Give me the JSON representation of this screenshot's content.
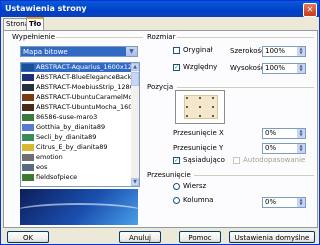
{
  "dialog": {
    "title": "Ustawienia strony",
    "close_glyph": "✕"
  },
  "tabs": [
    {
      "label": "Strona"
    },
    {
      "label": "Tło"
    }
  ],
  "fill": {
    "section_label": "Wypełnienie",
    "type_value": "Mapa bitowe",
    "images": [
      {
        "name": "ABSTRACT-Aquarius_1600x1200",
        "color": "#1b4f9b"
      },
      {
        "name": "ABSTRACT-BlueEleganceBackgrou",
        "color": "#1f2f7a"
      },
      {
        "name": "ABSTRACT-MoebiusStrip_1280x10",
        "color": "#27313d"
      },
      {
        "name": "ABSTRACT-UbuntuCaramelMocha",
        "color": "#7a3b12"
      },
      {
        "name": "ABSTRACT-UbuntuMocha_1600x1",
        "color": "#4a2a15"
      },
      {
        "name": "86586-suse-maro3",
        "color": "#3a7a3a"
      },
      {
        "name": "Gotthia_by_dianita89",
        "color": "#5a7ad0"
      },
      {
        "name": "Secli_by_dianita89",
        "color": "#3a8a5a"
      },
      {
        "name": "Citrus_E_by_dianita89",
        "color": "#d8b830"
      },
      {
        "name": "emotion",
        "color": "#6f6f6f"
      },
      {
        "name": "eos",
        "color": "#5a6a80"
      },
      {
        "name": "fieldsofpiece",
        "color": "#3d7a30"
      }
    ]
  },
  "size": {
    "section_label": "Rozmiar",
    "original_label": "Oryginał",
    "relative_label": "Względny",
    "width_label": "Szerokość",
    "height_label": "Wysokość",
    "width_value": "100%",
    "height_value": "100%"
  },
  "position": {
    "section_label": "Pozycja",
    "offset_x_label": "Przesunięcie X",
    "offset_y_label": "Przesunięcie Y",
    "offset_x_value": "0%",
    "offset_y_value": "0%",
    "tile_label": "Sąsiadująco",
    "autofit_label": "Autodopasowanie"
  },
  "shift": {
    "section_label": "Przesunięcie",
    "row_label": "Wiersz",
    "column_label": "Kolumna",
    "value": "0%"
  },
  "buttons": {
    "ok": "OK",
    "cancel": "Anuluj",
    "help": "Pomoc",
    "defaults": "Ustawienia domyślne"
  }
}
